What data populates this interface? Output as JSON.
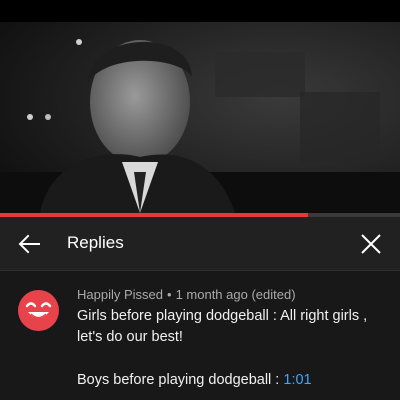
{
  "video": {
    "progress_percent": 77
  },
  "header": {
    "title": "Replies",
    "back_icon": "arrow-left-icon",
    "close_icon": "close-icon"
  },
  "comment": {
    "author": "Happily Pissed",
    "separator": "•",
    "time": "1 month ago (edited)",
    "text_line1": "Girls before playing dodgeball : All right girls , let's do our best!",
    "text_line2_prefix": "Boys before playing dodgeball : ",
    "text_line2_timestamp": "1:01",
    "avatar_icon": "smiling-face-icon",
    "avatar_color": "#e8434b"
  },
  "colors": {
    "accent": "#e53935",
    "link": "#3ea6ff",
    "background": "#181818",
    "header_background": "#212121"
  }
}
